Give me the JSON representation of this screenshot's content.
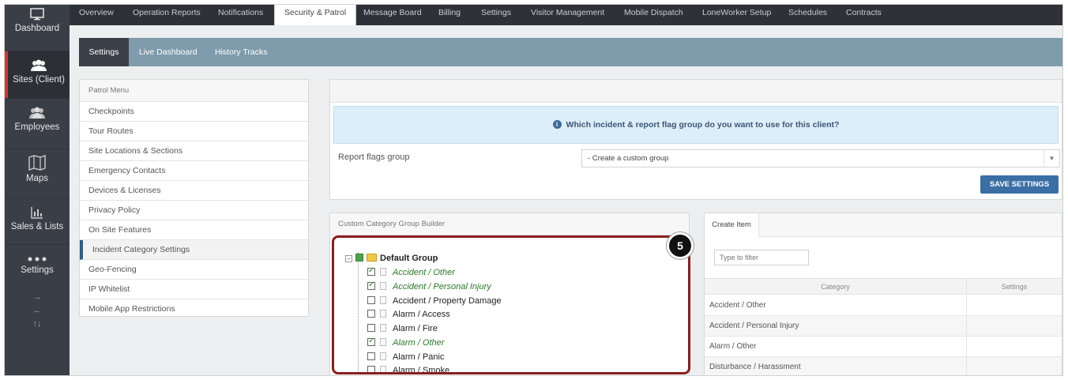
{
  "left_nav": [
    {
      "label": "Dashboard",
      "icon": "monitor-icon"
    },
    {
      "label": "Sites (Client)",
      "icon": "users-group-icon",
      "active": true
    },
    {
      "label": "Employees",
      "icon": "employees-icon"
    },
    {
      "label": "Maps",
      "icon": "map-icon"
    },
    {
      "label": "Sales & Lists",
      "icon": "bar-chart-icon"
    },
    {
      "label": "Settings",
      "icon": "dots-icon"
    }
  ],
  "arrows": {
    "right": "→",
    "left": "←",
    "updown": "↑↓"
  },
  "top_tabs": [
    "Overview",
    "Operation Reports",
    "Notifications",
    "Security & Patrol",
    "Message Board",
    "Billing",
    "Settings",
    "Visitor Management",
    "Mobile Dispatch",
    "LoneWorker Setup",
    "Schedules",
    "Contracts"
  ],
  "top_tab_active": "Security & Patrol",
  "sub_tabs": [
    "Settings",
    "Live Dashboard",
    "History Tracks"
  ],
  "patrol_menu": {
    "title": "Patrol Menu",
    "items": [
      "Checkpoints",
      "Tour Routes",
      "Site Locations & Sections",
      "Emergency Contacts",
      "Devices & Licenses",
      "Privacy Policy",
      "On Site Features",
      "Incident Category Settings",
      "Geo-Fencing",
      "IP Whitelist",
      "Mobile App Restrictions"
    ],
    "active": "Incident Category Settings"
  },
  "settings": {
    "info_text": "Which incident & report flag group do you want to use for this client?",
    "report_flags_label": "Report flags group",
    "report_flags_value": "- Create a custom group",
    "save_label": "SAVE SETTINGS"
  },
  "builder": {
    "title": "Custom Category Group Builder",
    "root": "Default Group",
    "items": [
      {
        "label": "Accident / Other",
        "checked": true
      },
      {
        "label": "Accident / Personal Injury",
        "checked": true
      },
      {
        "label": "Accident / Property Damage",
        "checked": false
      },
      {
        "label": "Alarm / Access",
        "checked": false
      },
      {
        "label": "Alarm / Fire",
        "checked": false
      },
      {
        "label": "Alarm / Other",
        "checked": true
      },
      {
        "label": "Alarm / Panic",
        "checked": false
      },
      {
        "label": "Alarm / Smoke",
        "checked": false
      }
    ]
  },
  "step_badge": "5",
  "create_item": {
    "tab": "Create Item",
    "filter_placeholder": "Type to filter",
    "col_category": "Category",
    "col_settings": "Settings",
    "rows": [
      "Accident / Other",
      "Accident / Personal Injury",
      "Alarm / Other",
      "Disturbance / Harassment"
    ]
  },
  "colors": {
    "accent": "#3a6ea5",
    "highlight_border": "#8b1d1d",
    "subbar": "#7e9cac",
    "nav_bg": "#3a3f47",
    "active_red": "#d9342b"
  }
}
